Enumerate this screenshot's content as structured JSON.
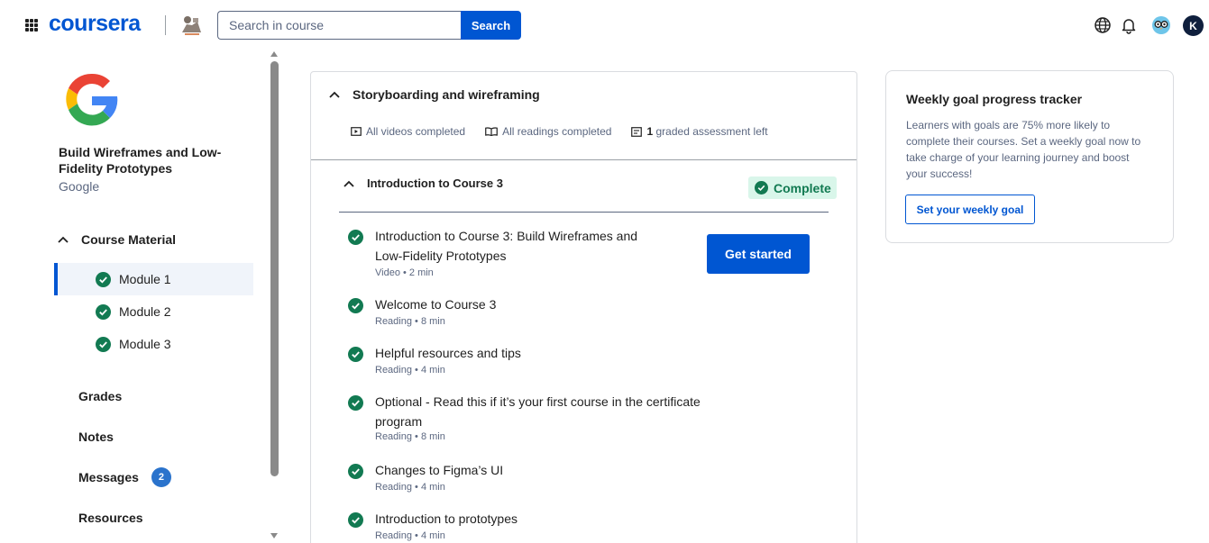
{
  "header": {
    "logo": "coursera",
    "search_placeholder": "Search in course",
    "search_button": "Search",
    "avatar_initial": "K"
  },
  "sidebar": {
    "course_title": "Build Wireframes and Low-Fidelity Prototypes",
    "course_org": "Google",
    "section_label": "Course Material",
    "modules": [
      {
        "label": "Module 1",
        "active": true,
        "completed": true
      },
      {
        "label": "Module 2",
        "active": false,
        "completed": true
      },
      {
        "label": "Module 3",
        "active": false,
        "completed": true
      }
    ],
    "nav": [
      {
        "label": "Grades"
      },
      {
        "label": "Notes"
      },
      {
        "label": "Messages",
        "badge": "2"
      },
      {
        "label": "Resources"
      }
    ]
  },
  "main": {
    "lesson_title": "Storyboarding and wireframing",
    "stats": {
      "videos": "All videos completed",
      "readings": "All readings completed",
      "graded_count": "1",
      "graded_text": "graded assessment left"
    },
    "sub_section": {
      "title": "Introduction to Course 3",
      "status": "Complete"
    },
    "get_started_label": "Get started",
    "items": [
      {
        "title": "Introduction to Course 3: Build Wireframes and Low-Fidelity Prototypes",
        "meta": "Video • 2 min"
      },
      {
        "title": "Welcome to Course 3",
        "meta": "Reading • 8 min"
      },
      {
        "title": "Helpful resources and tips",
        "meta": "Reading • 4 min"
      },
      {
        "title": "Optional - Read this if it’s your first course in the certificate program",
        "meta": "Reading • 8 min"
      },
      {
        "title": "Changes to Figma’s UI",
        "meta": "Reading • 4 min"
      },
      {
        "title": "Introduction to prototypes",
        "meta": "Reading • 4 min"
      }
    ]
  },
  "goal_card": {
    "title": "Weekly goal progress tracker",
    "text": "Learners with goals are 75% more likely to complete their courses. Set a weekly goal now to take charge of your learning journey and boost your success!",
    "button": "Set your weekly goal"
  },
  "colors": {
    "brand": "#0056d2",
    "success": "#127a52",
    "success_bg": "#d9f6ea"
  }
}
